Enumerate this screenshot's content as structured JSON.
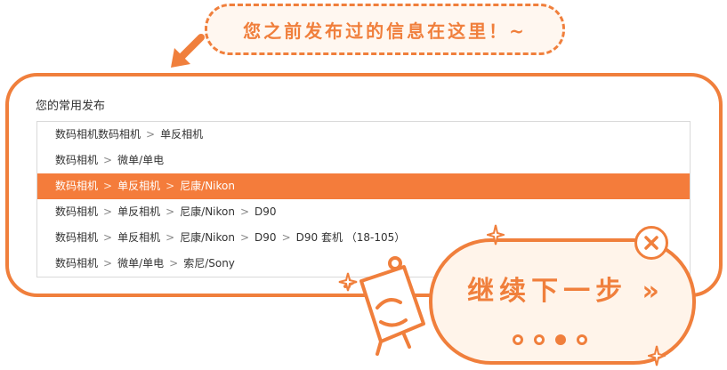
{
  "bubble": {
    "text": "您之前发布过的信息在这里！~"
  },
  "panel": {
    "title": "您的常用发布"
  },
  "rows": [
    {
      "parts": [
        "数码相机数码相机",
        "单反相机"
      ],
      "selected": false
    },
    {
      "parts": [
        "数码相机",
        "微单/单电"
      ],
      "selected": false
    },
    {
      "parts": [
        "数码相机",
        "单反相机",
        "尼康/Nikon"
      ],
      "selected": true
    },
    {
      "parts": [
        "数码相机",
        "单反相机",
        "尼康/Nikon",
        "D90"
      ],
      "selected": false
    },
    {
      "parts": [
        "数码相机",
        "单反相机",
        "尼康/Nikon",
        "D90",
        "D90 套机 （18-105）"
      ],
      "selected": false
    },
    {
      "parts": [
        "数码相机",
        "微单/单电",
        "索尼/Sony"
      ],
      "selected": false
    }
  ],
  "separator": ">",
  "next": {
    "label": "继续下一步 »"
  },
  "pager": {
    "total": 4,
    "current": 3
  },
  "colors": {
    "accent": "#f07f3c",
    "selected_row": "#f47c3b"
  },
  "icons": {
    "arrow": "arrow-down-left-icon",
    "close": "close-circle-icon",
    "mascot": "mascot-icon",
    "sparkle": "sparkle-icon"
  }
}
